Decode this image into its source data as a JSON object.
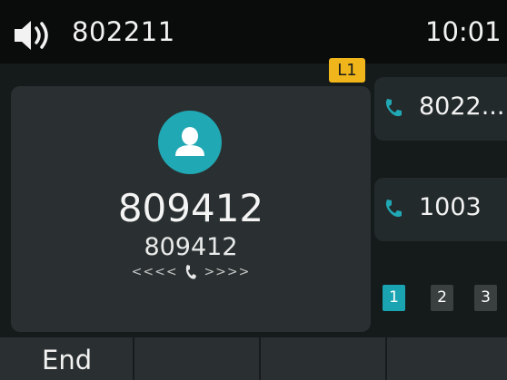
{
  "status": {
    "account": "802211",
    "time": "10:01",
    "speaker_icon": "speaker-icon"
  },
  "line_badge": "L1",
  "call": {
    "name": "809412",
    "number": "809412",
    "progress_left": "<<<<",
    "progress_right": ">>>>",
    "avatar_icon": "contact-avatar-icon",
    "accent_color": "#21a8b5"
  },
  "lines": [
    {
      "label": "8022...",
      "icon": "handset-icon"
    },
    {
      "label": "1003",
      "icon": "handset-icon"
    }
  ],
  "pages": [
    "1",
    "2",
    "3"
  ],
  "active_page": "1",
  "softkeys": [
    "End",
    "",
    "",
    ""
  ]
}
